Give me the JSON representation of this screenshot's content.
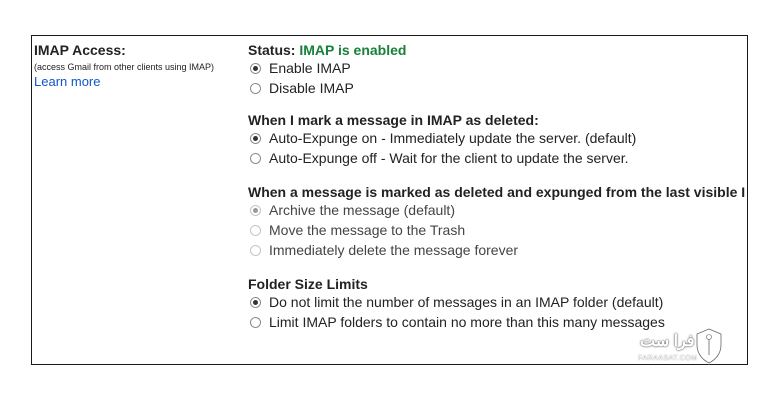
{
  "imap": {
    "title": "IMAP Access:",
    "subtitle": "(access Gmail from other clients using IMAP)",
    "learn_more": "Learn more",
    "status_label": "Status:",
    "status_value": "IMAP is enabled",
    "status_color": "#188038",
    "access_options": [
      {
        "label": "Enable IMAP",
        "checked": true
      },
      {
        "label": "Disable IMAP",
        "checked": false
      }
    ]
  },
  "deleted_section": {
    "heading": "When I mark a message in IMAP as deleted:",
    "options": [
      {
        "label": "Auto-Expunge on - Immediately update the server. (default)",
        "checked": true
      },
      {
        "label": "Auto-Expunge off - Wait for the client to update the server.",
        "checked": false
      }
    ]
  },
  "expunged_section": {
    "heading": "When a message is marked as deleted and expunged from the last visible I",
    "options": [
      {
        "label": "Archive the message (default)",
        "checked": true,
        "disabled": true
      },
      {
        "label": "Move the message to the Trash",
        "checked": false,
        "disabled": true
      },
      {
        "label": "Immediately delete the message forever",
        "checked": false,
        "disabled": true
      }
    ]
  },
  "folder_section": {
    "heading": "Folder Size Limits",
    "options": [
      {
        "label": "Do not limit the number of messages in an IMAP folder (default)",
        "checked": true
      },
      {
        "label": "Limit IMAP folders to contain no more than this many messages",
        "checked": false
      }
    ]
  },
  "watermark": {
    "text": "فرا ست",
    "sub": "FARAASAT.COM"
  }
}
